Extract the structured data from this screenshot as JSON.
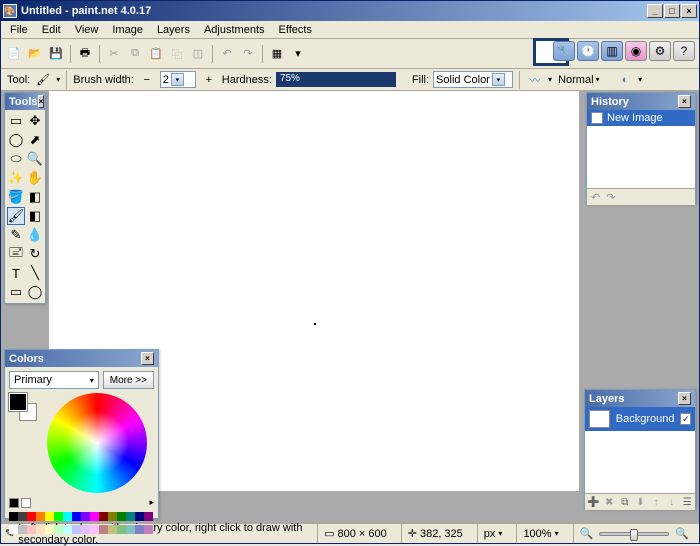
{
  "title": "Untitled - paint.net 4.0.17",
  "menu": [
    "File",
    "Edit",
    "View",
    "Image",
    "Layers",
    "Adjustments",
    "Effects"
  ],
  "toolbar2": {
    "tool_label": "Tool:",
    "brush_width_label": "Brush width:",
    "brush_width_value": "2",
    "hardness_label": "Hardness:",
    "hardness_value": "75%",
    "fill_label": "Fill:",
    "fill_value": "Solid Color",
    "blend_value": "Normal"
  },
  "panels": {
    "tools_title": "Tools",
    "history_title": "History",
    "history_item": "New Image",
    "colors_title": "Colors",
    "colors_primary": "Primary",
    "colors_more": "More >>",
    "layers_title": "Layers",
    "layer_name": "Background"
  },
  "status": {
    "hint": "Left click to draw with primary color, right click to draw with secondary color.",
    "canvas_size": "800 × 600",
    "cursor_pos": "382, 325",
    "unit": "px",
    "zoom": "100%"
  },
  "palette_top": [
    "#000",
    "#404040",
    "#ff0000",
    "#ff8000",
    "#ffff00",
    "#00ff00",
    "#00ffff",
    "#0000ff",
    "#8000ff",
    "#ff00ff",
    "#800000",
    "#808000",
    "#008000",
    "#008080",
    "#000080",
    "#800080"
  ],
  "palette_bot": [
    "#fff",
    "#c0c0c0",
    "#ffc0c0",
    "#ffe0c0",
    "#ffffc0",
    "#c0ffc0",
    "#c0ffff",
    "#c0c0ff",
    "#e0c0ff",
    "#ffc0ff",
    "#c08080",
    "#c0c080",
    "#80c080",
    "#80c0c0",
    "#8080c0",
    "#c080c0"
  ]
}
